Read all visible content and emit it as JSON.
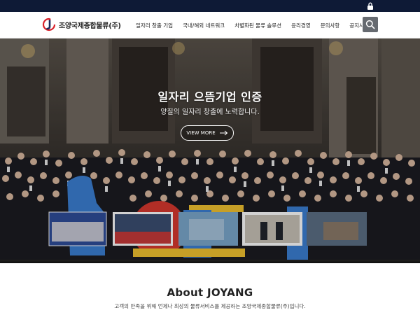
{
  "topbar": {
    "lock_icon": "lock-icon"
  },
  "header": {
    "logo_text": "조양국제종합물류(주)",
    "logo_colors": {
      "red": "#d8202a",
      "navy": "#1a2a5c"
    }
  },
  "nav": {
    "items": [
      {
        "label": "일자리 창출 기업"
      },
      {
        "label": "국내/해외 네트워크"
      },
      {
        "label": "차별화된 물류 솔루션"
      },
      {
        "label": "윤리경영"
      },
      {
        "label": "문의사항"
      },
      {
        "label": "공지사항"
      }
    ],
    "search_icon": "search-icon"
  },
  "hero": {
    "title": "일자리 으뜸기업 인증",
    "subtitle": "양질의 일자리 창출에 노력합니다.",
    "button_label": "VIEW MORE"
  },
  "about": {
    "title": "About JOYANG",
    "description": "고객의 만족을 위해 언제나 최상의 물류서비스를 제공하는 조양국제종합물류(주)입니다."
  },
  "colors": {
    "topbar": "#0e1a36",
    "search_button": "#666a70",
    "hero_bg": "#3b3835"
  }
}
